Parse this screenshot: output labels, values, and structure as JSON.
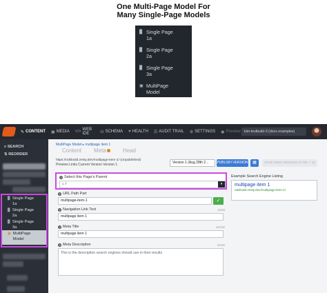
{
  "heading": {
    "line1": "One Multi-Page Model For",
    "line2": "Many Single-Page Models"
  },
  "mini_menu": [
    {
      "icon": "page-icon",
      "line1": "Single Page",
      "line2": "1a"
    },
    {
      "icon": "page-icon",
      "line1": "Single Page",
      "line2": "2a"
    },
    {
      "icon": "page-icon",
      "line1": "Single Page",
      "line2": "3a"
    },
    {
      "icon": "multipage-icon",
      "line1": "MultiPage",
      "line2": "Model"
    }
  ],
  "topnav": {
    "items": [
      {
        "label": "CONTENT",
        "icon": "pencil-icon"
      },
      {
        "label": "MEDIA",
        "icon": "image-icon"
      },
      {
        "label": "WEB IDE",
        "icon": "code-icon"
      },
      {
        "label": "SCHEMA",
        "icon": "database-icon"
      },
      {
        "label": "HEALTH",
        "icon": "heart-icon"
      },
      {
        "label": "AUDIT TRAIL",
        "icon": "list-icon"
      },
      {
        "label": "SETTINGS",
        "icon": "gear-icon"
      },
      {
        "label": "Preview",
        "icon": "eye-icon"
      }
    ],
    "site": "kim-testbuild-3 (docs examples)"
  },
  "sidebar": {
    "search": "SEARCH",
    "reorder": "REORDER",
    "items": [
      {
        "line1": "Single Page",
        "line2": "1a"
      },
      {
        "line1": "Single Page",
        "line2": "2a"
      },
      {
        "line1": "Single Page",
        "line2": "3a"
      },
      {
        "line1": "MultiPage",
        "line2": "Model"
      }
    ]
  },
  "editor": {
    "breadcrumb": "MultiPage Model ▸ multipage item 1",
    "tabs": [
      "Content",
      "Meta",
      "Head"
    ],
    "url_line": "https://ndsbuild.zesty.dev/multipage-item-1/ (Unpublished)",
    "preview_links": "Preview Links  Current Version  Version 1",
    "version_button": "Version 1 (Aug 28th 2...",
    "publish_button": "PUBLISH VERSION 1",
    "save_button": "SAVE NEW VERSION (CTRL + S)",
    "parent_label": "Select this Page's Parent",
    "parent_value": "/",
    "url_path_label": "URL Path Part",
    "url_path_value": "multipage-item-1",
    "nav_label": "Navigation Link Text",
    "nav_count": "16/38",
    "nav_value": "multipage item 1",
    "meta_title_label": "Meta Title",
    "meta_title_count": "16/150",
    "meta_title_value": "multipage item 1",
    "meta_desc_label": "Meta Description",
    "meta_desc_count": "0/160",
    "meta_desc_placeholder": "This is the description search engines should use in their results",
    "seo_label": "Example Search Engine Listing",
    "seo_title": "multipage item 1",
    "seo_url": "ndsbuild.zesty.dev/multipage-item-1/"
  },
  "colors": {
    "highlight": "#c94ae0",
    "publish": "#3a7bd5",
    "brand": "#e25a1c"
  }
}
